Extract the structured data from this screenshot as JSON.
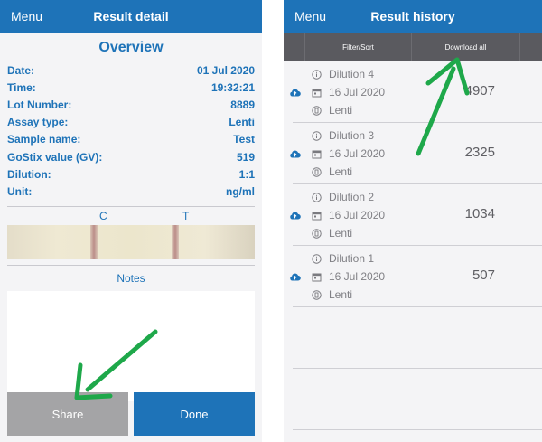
{
  "left": {
    "menu_label": "Menu",
    "title": "Result detail",
    "section_title": "Overview",
    "details": [
      {
        "label": "Date:",
        "value": "01 Jul 2020"
      },
      {
        "label": "Time:",
        "value": "19:32:21"
      },
      {
        "label": "Lot Number:",
        "value": "8889"
      },
      {
        "label": "Assay type:",
        "value": "Lenti"
      },
      {
        "label": "Sample name:",
        "value": "Test"
      },
      {
        "label": "GoStix value (GV):",
        "value": "519"
      },
      {
        "label": "Dilution:",
        "value": "1:1"
      },
      {
        "label": "Unit:",
        "value": "ng/ml"
      }
    ],
    "strip_label_c": "C",
    "strip_label_t": "T",
    "notes_label": "Notes",
    "share_label": "Share",
    "done_label": "Done"
  },
  "right": {
    "menu_label": "Menu",
    "title": "Result history",
    "filter_label": "Filter/Sort",
    "download_label": "Download all",
    "results": [
      {
        "name": "Dilution 4",
        "date": "16 Jul 2020",
        "assay": "Lenti",
        "value": "4907"
      },
      {
        "name": "Dilution 3",
        "date": "16 Jul 2020",
        "assay": "Lenti",
        "value": "2325"
      },
      {
        "name": "Dilution 2",
        "date": "16 Jul 2020",
        "assay": "Lenti",
        "value": "1034"
      },
      {
        "name": "Dilution 1",
        "date": "16 Jul 2020",
        "assay": "Lenti",
        "value": "507"
      }
    ]
  },
  "colors": {
    "brand": "#1e73b8",
    "arrow": "#1ea84a",
    "share_button": "#a4a4a6"
  },
  "icons": [
    "info-icon",
    "calendar-icon",
    "assay-icon",
    "cloud-upload-icon"
  ]
}
